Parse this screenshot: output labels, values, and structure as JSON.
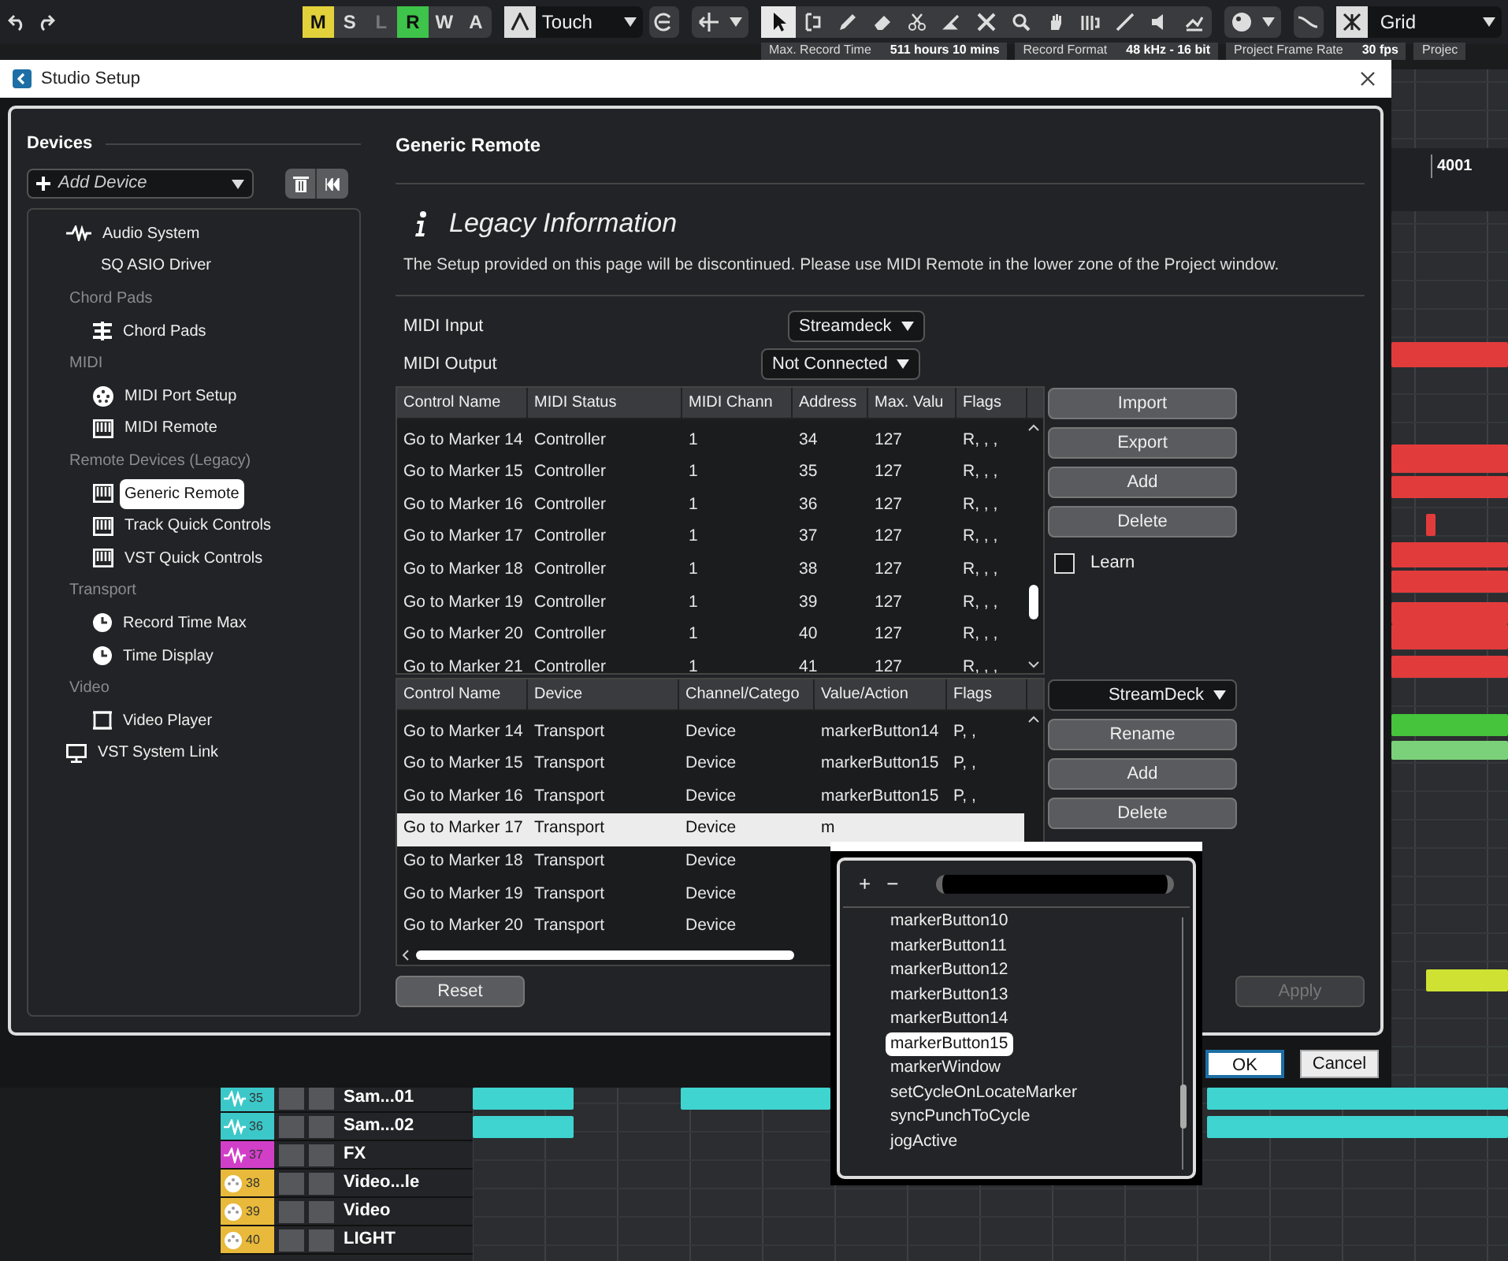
{
  "toolbar": {
    "automation_modes": [
      {
        "label": "M",
        "on": true,
        "color": "#e3d13b"
      },
      {
        "label": "S",
        "on": false
      },
      {
        "label": "L",
        "on": false,
        "disabled": true
      },
      {
        "label": "R",
        "on": true,
        "color": "#3ec44a"
      },
      {
        "label": "W",
        "on": false
      },
      {
        "label": "A",
        "on": false
      }
    ],
    "automation_mode": {
      "value": "Touch"
    },
    "tools": [
      {
        "kind": "arrow",
        "selected": true
      },
      {
        "kind": "range",
        "selected": false
      },
      {
        "kind": "pencil",
        "selected": false
      },
      {
        "kind": "eraser",
        "selected": false
      },
      {
        "kind": "scissors",
        "selected": false
      },
      {
        "kind": "glue",
        "selected": false
      },
      {
        "kind": "mute",
        "selected": false
      },
      {
        "kind": "zoom",
        "selected": false
      },
      {
        "kind": "hand",
        "selected": false
      },
      {
        "kind": "comp",
        "selected": false
      },
      {
        "kind": "line",
        "selected": false
      },
      {
        "kind": "speaker",
        "selected": false
      },
      {
        "kind": "warp",
        "selected": false
      }
    ],
    "snap": {
      "value": "Grid"
    }
  },
  "info_bar": [
    {
      "label": "Max. Record Time",
      "value": "511 hours 10 mins"
    },
    {
      "label": "Record Format",
      "value": "48 kHz - 16 bit"
    },
    {
      "label": "Project Frame Rate",
      "value": "30 fps"
    },
    {
      "label": "Projec"
    }
  ],
  "ruler": [
    "4001"
  ],
  "tracks": [
    {
      "number": "35",
      "name": "Sam...01",
      "kind": "audio",
      "color": "#3cc8c8"
    },
    {
      "number": "36",
      "name": "Sam...02",
      "kind": "audio",
      "color": "#3cc8c8"
    },
    {
      "number": "37",
      "name": "FX",
      "kind": "audio",
      "color": "#d13fc8"
    },
    {
      "number": "38",
      "name": "Video...le",
      "kind": "midi",
      "color": "#e8b93a"
    },
    {
      "number": "39",
      "name": "Video",
      "kind": "midi",
      "color": "#e8b93a"
    },
    {
      "number": "40",
      "name": "LIGHT",
      "kind": "midi",
      "color": "#e8b93a"
    }
  ],
  "dialog": {
    "title": "Studio Setup",
    "devices": {
      "heading": "Devices",
      "add_device": {
        "placeholder": "Add Device"
      },
      "items": [
        {
          "label": "Audio System",
          "kind": "wave",
          "selected": false,
          "children": [
            {
              "label": "SQ ASIO Driver",
              "kind": "plain",
              "selected": false
            }
          ]
        },
        {
          "label": "Chord Pads",
          "kind": "category",
          "children": [
            {
              "label": "Chord Pads",
              "kind": "pads",
              "selected": false
            }
          ]
        },
        {
          "label": "MIDI",
          "kind": "category",
          "children": [
            {
              "label": "MIDI Port Setup",
              "kind": "port",
              "selected": false
            },
            {
              "label": "MIDI Remote",
              "kind": "keyboard",
              "selected": false
            }
          ]
        },
        {
          "label": "Remote Devices (Legacy)",
          "kind": "category",
          "children": [
            {
              "label": "Generic Remote",
              "kind": "keyboard",
              "selected": true
            },
            {
              "label": "Track Quick Controls",
              "kind": "keyboard",
              "selected": false
            },
            {
              "label": "VST Quick Controls",
              "kind": "keyboard",
              "selected": false
            }
          ]
        },
        {
          "label": "Transport",
          "kind": "category",
          "children": [
            {
              "label": "Record Time Max",
              "kind": "clock",
              "selected": false
            },
            {
              "label": "Time Display",
              "kind": "clock",
              "selected": false
            }
          ]
        },
        {
          "label": "Video",
          "kind": "category",
          "children": [
            {
              "label": "Video Player",
              "kind": "film",
              "selected": false
            }
          ]
        },
        {
          "label": "VST System Link",
          "kind": "monitor",
          "selected": false
        }
      ]
    },
    "page": {
      "heading": "Generic Remote",
      "notice_title": "Legacy Information",
      "notice": "The Setup provided on this page will be discontinued. Please use MIDI Remote in the lower zone of the Project window.",
      "midi_input": {
        "label": "MIDI Input",
        "value": "Streamdeck"
      },
      "midi_output": {
        "label": "MIDI Output",
        "value": "Not Connected"
      },
      "controls_table": {
        "columns": [
          "Control Name",
          "MIDI Status",
          "MIDI Chann",
          "Address",
          "Max. Valu",
          "Flags"
        ],
        "rows": [
          [
            "Go to Marker 14",
            "Controller",
            "1",
            "34",
            "127",
            "R, , ,"
          ],
          [
            "Go to Marker 15",
            "Controller",
            "1",
            "35",
            "127",
            "R, , ,"
          ],
          [
            "Go to Marker 16",
            "Controller",
            "1",
            "36",
            "127",
            "R, , ,"
          ],
          [
            "Go to Marker 17",
            "Controller",
            "1",
            "37",
            "127",
            "R, , ,"
          ],
          [
            "Go to Marker 18",
            "Controller",
            "1",
            "38",
            "127",
            "R, , ,"
          ],
          [
            "Go to Marker 19",
            "Controller",
            "1",
            "39",
            "127",
            "R, , ,"
          ],
          [
            "Go to Marker 20",
            "Controller",
            "1",
            "40",
            "127",
            "R, , ,"
          ],
          [
            "Go to Marker 21",
            "Controller",
            "1",
            "41",
            "127",
            "R, , ,"
          ]
        ]
      },
      "controls_buttons": [
        "Import",
        "Export",
        "Add",
        "Delete"
      ],
      "learn": {
        "label": "Learn",
        "checked": false
      },
      "actions_table": {
        "columns": [
          "Control Name",
          "Device",
          "Channel/Catego",
          "Value/Action",
          "Flags"
        ],
        "rows": [
          {
            "cells": [
              "Go to Marker 14",
              "Transport",
              "Device",
              "markerButton14",
              "P, ,"
            ],
            "selected": false
          },
          {
            "cells": [
              "Go to Marker 15",
              "Transport",
              "Device",
              "markerButton15",
              "P, ,"
            ],
            "selected": false
          },
          {
            "cells": [
              "Go to Marker 16",
              "Transport",
              "Device",
              "markerButton15",
              "P, ,"
            ],
            "selected": false
          },
          {
            "cells": [
              "Go to Marker 17",
              "Transport",
              "Device",
              "m"
            ],
            "selected": true
          },
          {
            "cells": [
              "Go to Marker 18",
              "Transport",
              "Device"
            ],
            "selected": false
          },
          {
            "cells": [
              "Go to Marker 19",
              "Transport",
              "Device"
            ],
            "selected": false
          },
          {
            "cells": [
              "Go to Marker 20",
              "Transport",
              "Device"
            ],
            "selected": false
          }
        ]
      },
      "bank": {
        "value": "StreamDeck"
      },
      "actions_buttons": [
        "Rename",
        "Add",
        "Delete"
      ],
      "reset": "Reset",
      "apply": {
        "label": "Apply",
        "disabled": true
      }
    },
    "buttons": [
      "OK",
      "Cancel"
    ]
  },
  "popup": {
    "add": "+",
    "remove": "−",
    "items": [
      {
        "label": "markerButton10",
        "selected": false
      },
      {
        "label": "markerButton11",
        "selected": false
      },
      {
        "label": "markerButton12",
        "selected": false
      },
      {
        "label": "markerButton13",
        "selected": false
      },
      {
        "label": "markerButton14",
        "selected": false
      },
      {
        "label": "markerButton15",
        "selected": true
      },
      {
        "label": "markerWindow",
        "selected": false
      },
      {
        "label": "setCycleOnLocateMarker",
        "selected": false
      },
      {
        "label": "syncPunchToCycle",
        "selected": false
      },
      {
        "label": "jogActive",
        "selected": false
      }
    ]
  }
}
